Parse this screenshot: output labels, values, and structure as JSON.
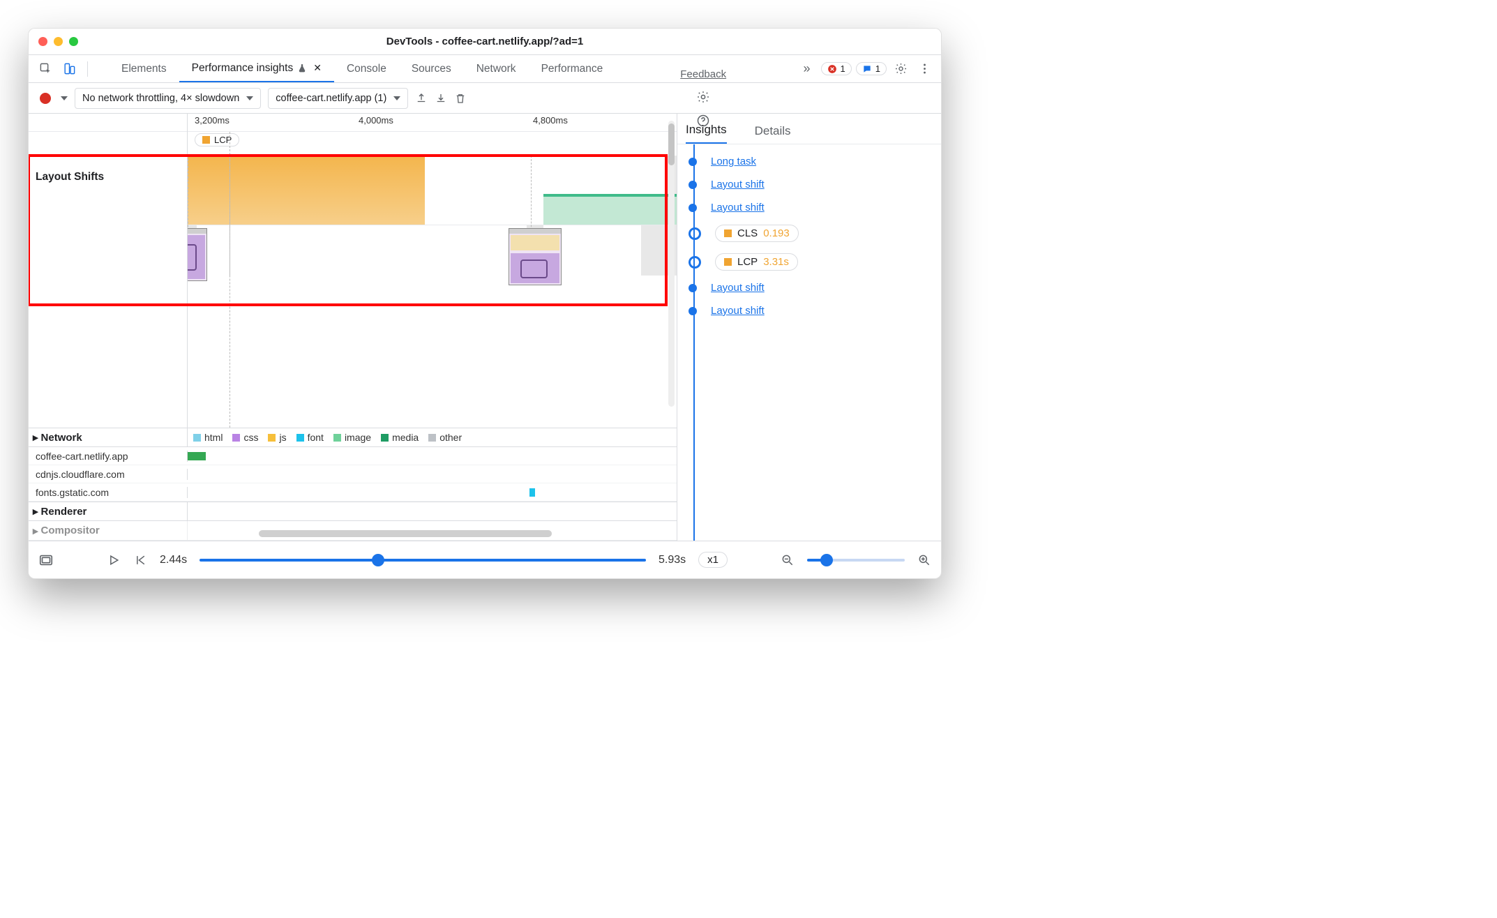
{
  "window": {
    "title": "DevTools - coffee-cart.netlify.app/?ad=1"
  },
  "tabstrip": {
    "elements": "Elements",
    "perf_insights": "Performance insights",
    "console": "Console",
    "sources": "Sources",
    "network": "Network",
    "performance": "Performance",
    "more_glyph": "»",
    "error_count": "1",
    "info_count": "1"
  },
  "toolbar": {
    "throttling": "No network throttling, 4× slowdown",
    "recording": "coffee-cart.netlify.app (1)",
    "feedback": "Feedback"
  },
  "timeline": {
    "ticks": [
      "3,200ms",
      "4,000ms",
      "4,800ms"
    ],
    "lcp_chip": "LCP",
    "layout_shifts_label": "Layout Shifts",
    "network_head": "Network",
    "renderer_head": "Renderer",
    "compositor_head": "Compositor",
    "legend": {
      "html": "html",
      "css": "css",
      "js": "js",
      "font": "font",
      "image": "image",
      "media": "media",
      "other": "other"
    },
    "hosts": [
      "coffee-cart.netlify.app",
      "cdnjs.cloudflare.com",
      "fonts.gstatic.com"
    ]
  },
  "insights": {
    "tab_insights": "Insights",
    "tab_details": "Details",
    "items": [
      {
        "type": "link",
        "label": "Long task"
      },
      {
        "type": "link",
        "label": "Layout shift"
      },
      {
        "type": "link",
        "label": "Layout shift"
      },
      {
        "type": "pill",
        "metric": "CLS",
        "value": "0.193",
        "color": "orange"
      },
      {
        "type": "pill",
        "metric": "LCP",
        "value": "3.31s",
        "color": "orange"
      },
      {
        "type": "link",
        "label": "Layout shift"
      },
      {
        "type": "link",
        "label": "Layout shift"
      }
    ]
  },
  "footer": {
    "start": "2.44s",
    "end": "5.93s",
    "speed": "x1"
  }
}
